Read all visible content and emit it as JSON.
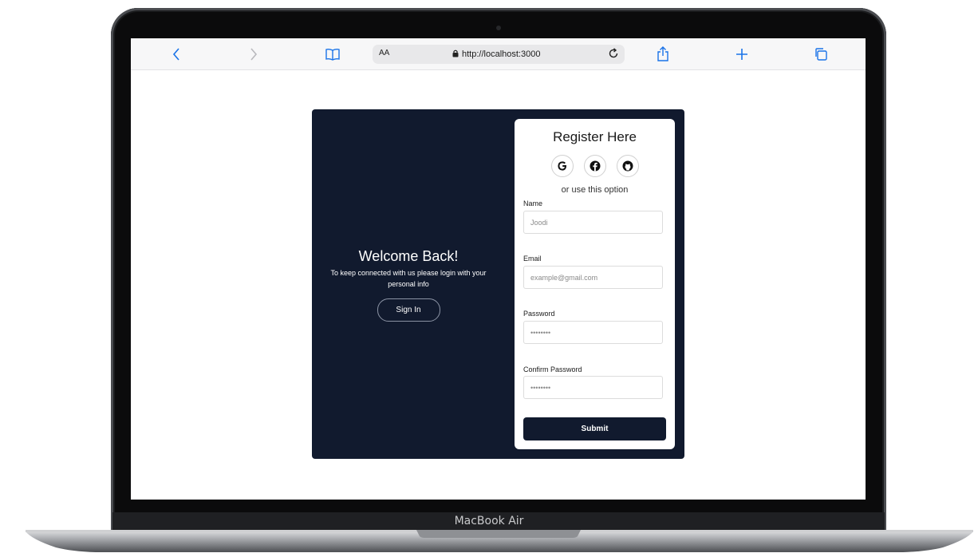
{
  "device": {
    "model_label": "MacBook Air"
  },
  "browser": {
    "reader_label": "AA",
    "url": "http://localhost:3000",
    "icons": {
      "back": "chevron-left-icon",
      "forward": "chevron-right-icon",
      "bookmarks": "book-icon",
      "lock": "lock-icon",
      "reload": "reload-icon",
      "share": "share-icon",
      "new_tab": "plus-icon",
      "tabs": "tabs-icon"
    },
    "accent_color": "#1a73e8"
  },
  "welcome_panel": {
    "title": "Welcome Back!",
    "message": "To keep connected with us please login with your personal info",
    "sign_in_label": "Sign In",
    "background_color": "#111a2e"
  },
  "register_form": {
    "title": "Register Here",
    "social_icons": [
      "google-icon",
      "facebook-icon",
      "github-icon"
    ],
    "divider_text": "or use this option",
    "fields": {
      "name": {
        "label": "Name",
        "placeholder": "Joodi"
      },
      "email": {
        "label": "Email",
        "placeholder": "example@gmail.com"
      },
      "password": {
        "label": "Password",
        "placeholder": "••••••••"
      },
      "confirm_password": {
        "label": "Confirm Password",
        "placeholder": "••••••••"
      }
    },
    "submit_label": "Submit"
  }
}
